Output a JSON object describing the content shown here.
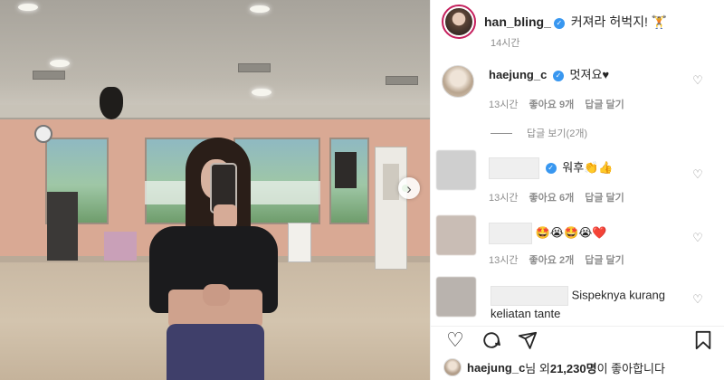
{
  "post": {
    "author": "han_bling_",
    "caption": "커져라 허벅지! 🏋",
    "time": "14시간"
  },
  "comments": [
    {
      "username": "haejung_c",
      "text": "멋져요♥",
      "time": "13시간",
      "likes": "좋아요 9개",
      "reply": "답글 달기",
      "view_replies": "답글 보기(2개)"
    },
    {
      "username": "",
      "verified": true,
      "text": "워후👏👍",
      "time": "13시간",
      "likes": "좋아요 6개",
      "reply": "답글 달기"
    },
    {
      "username": "",
      "text": "🤩😭🤩😭❤️",
      "time": "13시간",
      "likes": "좋아요 2개",
      "reply": "답글 달기"
    },
    {
      "username": "",
      "text": "Sispeknya kurang keliatan tante"
    }
  ],
  "likes_summary": {
    "user": "haejung_c",
    "prefix": "님 외 ",
    "count": "21,230명",
    "suffix": "이 좋아합니다"
  },
  "icons": {
    "like": "heart-outline-icon",
    "comment": "comment-bubble-icon",
    "share": "paper-plane-icon",
    "save": "bookmark-icon",
    "next": "chevron-right-icon"
  }
}
